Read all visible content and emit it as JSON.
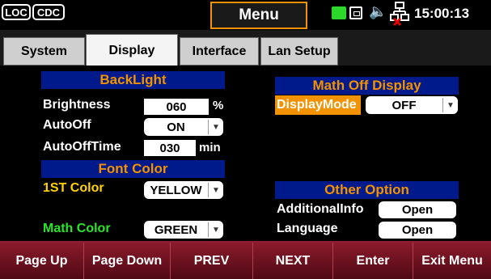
{
  "status": {
    "loc_label": "LOC",
    "cdc_label": "CDC",
    "mode_title": "Menu",
    "time": "15:00:13",
    "icons": [
      "battery-icon",
      "lan-icon",
      "speaker-icon",
      "network-disconnected-icon"
    ]
  },
  "tabs": [
    {
      "label": "System",
      "active": false
    },
    {
      "label": "Display",
      "active": true
    },
    {
      "label": "Interface",
      "active": false
    },
    {
      "label": "Lan Setup",
      "active": false
    }
  ],
  "backlight": {
    "header": "BackLight",
    "brightness_label": "Brightness",
    "brightness_value": "060",
    "brightness_unit": "%",
    "autooff_label": "AutoOff",
    "autooff_value": "ON",
    "autoofftime_label": "AutoOffTime",
    "autoofftime_value": "030",
    "autoofftime_unit": "min"
  },
  "font_color": {
    "header": "Font Color",
    "first_label": "1ST Color",
    "first_value": "YELLOW",
    "math_label": "Math Color",
    "math_value": "GREEN"
  },
  "math_off": {
    "header": "Math Off Display",
    "mode_label": "DisplayMode",
    "mode_value": "OFF"
  },
  "other": {
    "header": "Other Option",
    "info_label": "AdditionalInfo",
    "info_button": "Open",
    "lang_label": "Language",
    "lang_button": "Open"
  },
  "softkeys": [
    "Page Up",
    "Page Down",
    "PREV",
    "NEXT",
    "Enter",
    "Exit Menu"
  ],
  "colors": {
    "accent_orange": "#f39200",
    "header_blue": "#001a8c",
    "softkey_red": "#6a0f1a",
    "yellow_text": "#ffd200",
    "green_text": "#29e629"
  }
}
